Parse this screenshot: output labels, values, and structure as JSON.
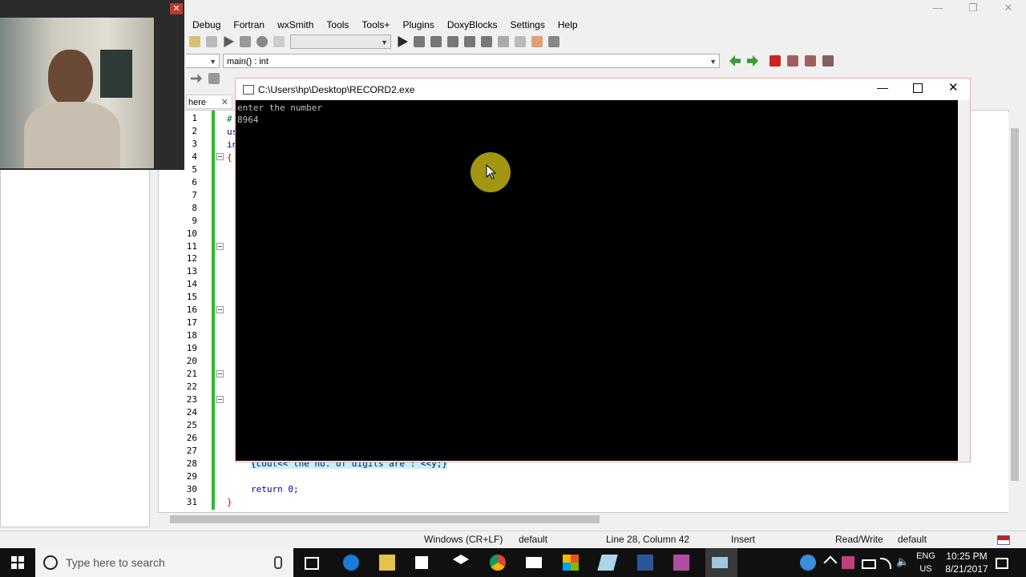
{
  "ide": {
    "menu": [
      "Debug",
      "Fortran",
      "wxSmith",
      "Tools",
      "Tools+",
      "Plugins",
      "DoxyBlocks",
      "Settings",
      "Help"
    ],
    "function_combo": "main() : int",
    "mgmt_tab_label": "here",
    "line_numbers": [
      "1",
      "2",
      "3",
      "4",
      "5",
      "6",
      "7",
      "8",
      "9",
      "10",
      "11",
      "12",
      "13",
      "14",
      "15",
      "16",
      "17",
      "18",
      "19",
      "20",
      "21",
      "22",
      "23",
      "24",
      "25",
      "26",
      "27",
      "28",
      "29",
      "30",
      "31"
    ],
    "code_fragments": {
      "l1": "#",
      "l2": "us",
      "l3": "in",
      "l4": "{",
      "l28": "{cout<<\"the no. of digits are :\"<<y;}",
      "l30": "return 0;",
      "l31": "}"
    },
    "status": {
      "eol": "Windows (CR+LF)",
      "encoding": "default",
      "position": "Line 28, Column 42",
      "mode": "Insert",
      "access": "Read/Write",
      "profile": "default"
    }
  },
  "console": {
    "title": "C:\\Users\\hp\\Desktop\\RECORD2.exe",
    "lines": [
      "enter the number",
      "8964"
    ]
  },
  "taskbar": {
    "search_placeholder": "Type here to search",
    "lang_top": "ENG",
    "lang_bottom": "US",
    "time": "10:25 PM",
    "date": "8/21/2017"
  },
  "colors": {
    "console_bg": "#000000",
    "console_text": "#c0c0c0",
    "change_bar": "#22c022",
    "cursor_halo": "#bfae14"
  }
}
